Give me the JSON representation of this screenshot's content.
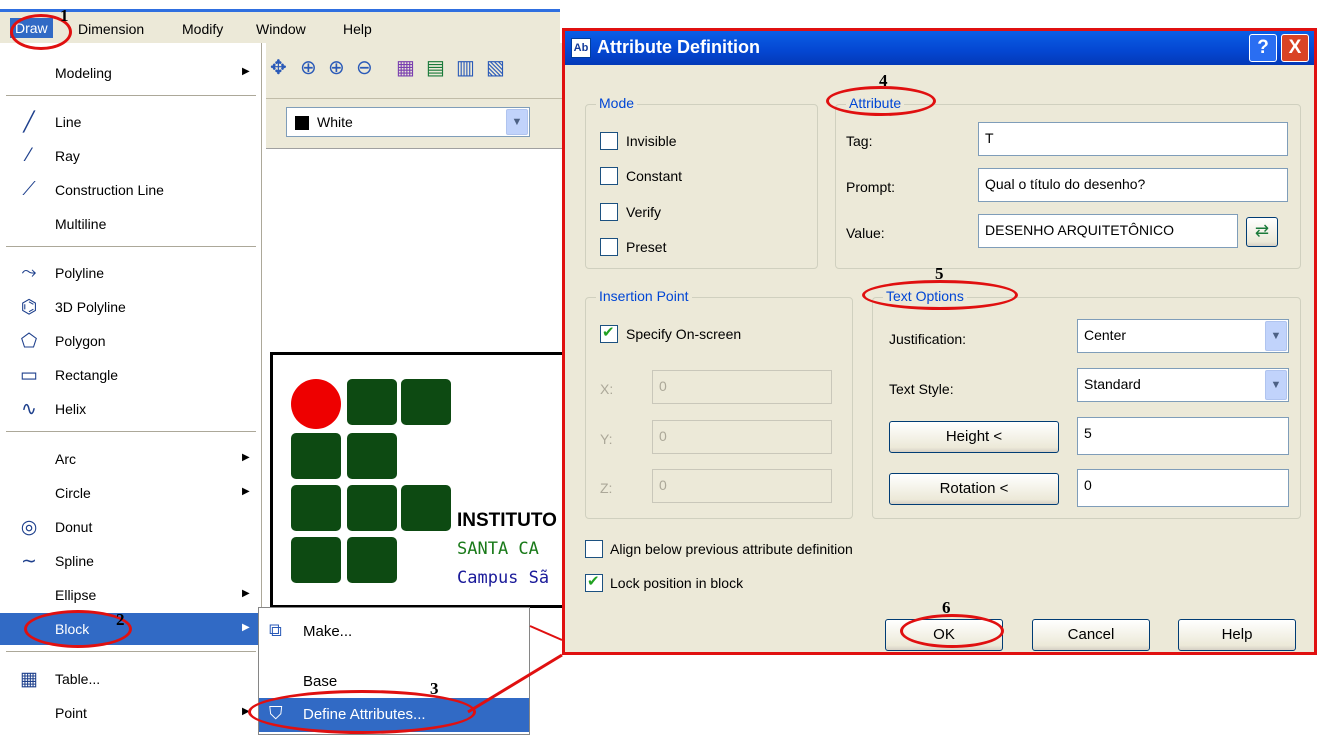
{
  "menubar": {
    "items": [
      "Draw",
      "Dimension",
      "Modify",
      "Window",
      "Help"
    ]
  },
  "toolbar": {
    "color_value": "White"
  },
  "draw_menu": {
    "modeling": "Modeling",
    "line": "Line",
    "ray": "Ray",
    "construction_line": "Construction Line",
    "multiline": "Multiline",
    "polyline": "Polyline",
    "polyline_3d": "3D Polyline",
    "polygon": "Polygon",
    "rectangle": "Rectangle",
    "helix": "Helix",
    "arc": "Arc",
    "circle": "Circle",
    "donut": "Donut",
    "spline": "Spline",
    "ellipse": "Ellipse",
    "block": "Block",
    "table": "Table...",
    "point": "Point"
  },
  "block_submenu": {
    "make": "Make...",
    "base": "Base",
    "define_attributes": "Define Attributes..."
  },
  "canvas": {
    "line1": "INSTITUTO",
    "line2": "SANTA CA",
    "line3": "Campus Sã"
  },
  "dialog": {
    "title": "Attribute Definition",
    "help_glyph": "?",
    "close_glyph": "X",
    "mode": {
      "title": "Mode",
      "invisible": "Invisible",
      "constant": "Constant",
      "verify": "Verify",
      "preset": "Preset"
    },
    "attribute": {
      "title": "Attribute",
      "tag_label": "Tag:",
      "tag_value": "T",
      "prompt_label": "Prompt:",
      "prompt_value": "Qual o título do desenho?",
      "value_label": "Value:",
      "value_value": "DESENHO ARQUITETÔNICO"
    },
    "insertion": {
      "title": "Insertion Point",
      "specify": "Specify On-screen",
      "x_label": "X:",
      "x_value": "0",
      "y_label": "Y:",
      "y_value": "0",
      "z_label": "Z:",
      "z_value": "0"
    },
    "text_options": {
      "title": "Text Options",
      "justification_label": "Justification:",
      "justification_value": "Center",
      "style_label": "Text Style:",
      "style_value": "Standard",
      "height_button": "Height <",
      "height_value": "5",
      "rotation_button": "Rotation <",
      "rotation_value": "0"
    },
    "align_below": "Align below previous attribute definition",
    "lock_position": "Lock position in block",
    "buttons": {
      "ok": "OK",
      "cancel": "Cancel",
      "help": "Help"
    }
  },
  "annotations": {
    "n1": "1",
    "n2": "2",
    "n3": "3",
    "n4": "4",
    "n5": "5",
    "n6": "6"
  },
  "colors": {
    "annotation_red": "#e01010",
    "menu_highlight": "#316ac5",
    "logo_green": "#0d4a12",
    "logo_red": "#ee0000",
    "group_title_blue": "#0046d5"
  }
}
